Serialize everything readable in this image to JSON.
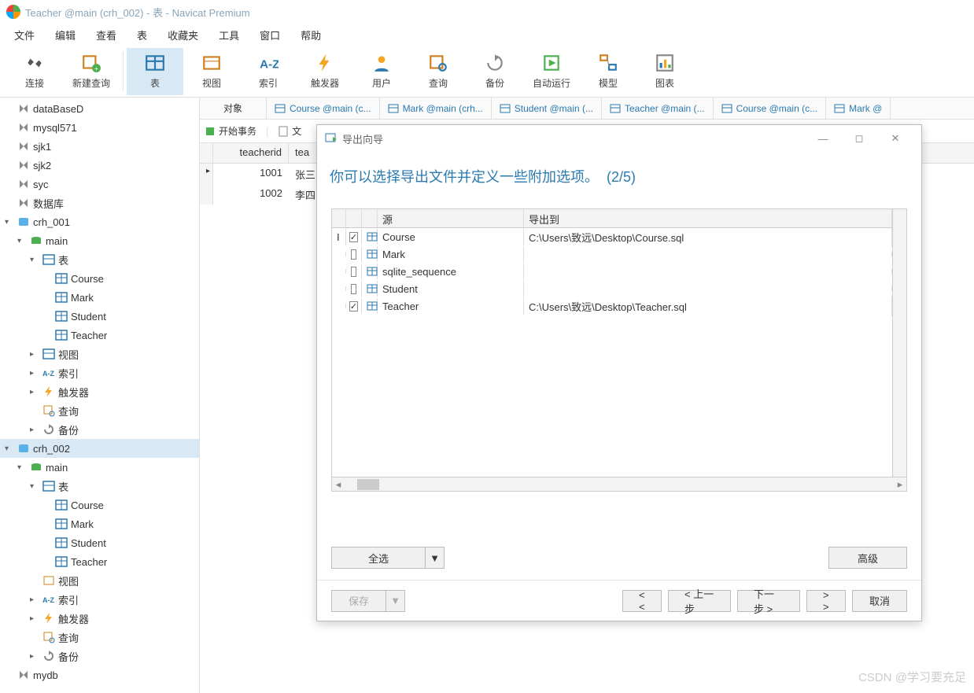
{
  "window": {
    "title": "Teacher @main (crh_002) - 表 - Navicat Premium"
  },
  "menu": [
    "文件",
    "编辑",
    "查看",
    "表",
    "收藏夹",
    "工具",
    "窗口",
    "帮助"
  ],
  "toolbar": [
    {
      "id": "connect",
      "label": "连接"
    },
    {
      "id": "newquery",
      "label": "新建查询"
    },
    {
      "id": "table",
      "label": "表",
      "active": true
    },
    {
      "id": "view",
      "label": "视图"
    },
    {
      "id": "index",
      "label": "索引"
    },
    {
      "id": "trigger",
      "label": "触发器"
    },
    {
      "id": "user",
      "label": "用户"
    },
    {
      "id": "query",
      "label": "查询"
    },
    {
      "id": "backup",
      "label": "备份"
    },
    {
      "id": "autorun",
      "label": "自动运行"
    },
    {
      "id": "model",
      "label": "模型"
    },
    {
      "id": "chart",
      "label": "图表"
    }
  ],
  "sidebar": [
    {
      "t": "conn",
      "label": "dataBaseD",
      "ind": 0
    },
    {
      "t": "conn",
      "label": "mysql571",
      "ind": 0
    },
    {
      "t": "conn",
      "label": "sjk1",
      "ind": 0
    },
    {
      "t": "conn",
      "label": "sjk2",
      "ind": 0
    },
    {
      "t": "conn",
      "label": "syc",
      "ind": 0
    },
    {
      "t": "conn",
      "label": "数据库",
      "ind": 0
    },
    {
      "t": "db",
      "label": "crh_001",
      "ind": 0,
      "caret": "▾",
      "open": true
    },
    {
      "t": "schema",
      "label": "main",
      "ind": 1,
      "caret": "▾"
    },
    {
      "t": "folder",
      "label": "表",
      "ind": 2,
      "caret": "▾"
    },
    {
      "t": "table",
      "label": "Course",
      "ind": 3
    },
    {
      "t": "table",
      "label": "Mark",
      "ind": 3
    },
    {
      "t": "table",
      "label": "Student",
      "ind": 3
    },
    {
      "t": "table",
      "label": "Teacher",
      "ind": 3
    },
    {
      "t": "folder",
      "label": "视图",
      "ind": 2,
      "caret": "▸"
    },
    {
      "t": "folder",
      "label": "索引",
      "ind": 2,
      "caret": "▸",
      "kind": "idx"
    },
    {
      "t": "folder",
      "label": "触发器",
      "ind": 2,
      "caret": "▸",
      "kind": "trg"
    },
    {
      "t": "folder",
      "label": "查询",
      "ind": 2,
      "kind": "qry"
    },
    {
      "t": "folder",
      "label": "备份",
      "ind": 2,
      "caret": "▸",
      "kind": "bak"
    },
    {
      "t": "db",
      "label": "crh_002",
      "ind": 0,
      "caret": "▾",
      "open": true,
      "selected": true
    },
    {
      "t": "schema",
      "label": "main",
      "ind": 1,
      "caret": "▾"
    },
    {
      "t": "folder",
      "label": "表",
      "ind": 2,
      "caret": "▾"
    },
    {
      "t": "table",
      "label": "Course",
      "ind": 3
    },
    {
      "t": "table",
      "label": "Mark",
      "ind": 3
    },
    {
      "t": "table",
      "label": "Student",
      "ind": 3
    },
    {
      "t": "table",
      "label": "Teacher",
      "ind": 3
    },
    {
      "t": "folder",
      "label": "视图",
      "ind": 2,
      "kind": "view"
    },
    {
      "t": "folder",
      "label": "索引",
      "ind": 2,
      "caret": "▸",
      "kind": "idx"
    },
    {
      "t": "folder",
      "label": "触发器",
      "ind": 2,
      "caret": "▸",
      "kind": "trg"
    },
    {
      "t": "folder",
      "label": "查询",
      "ind": 2,
      "kind": "qry"
    },
    {
      "t": "folder",
      "label": "备份",
      "ind": 2,
      "caret": "▸",
      "kind": "bak"
    },
    {
      "t": "conn",
      "label": "mydb",
      "ind": 0
    }
  ],
  "tabs": {
    "first": "对象",
    "items": [
      "Course @main (c...",
      "Mark @main (crh...",
      "Student @main (...",
      "Teacher @main (...",
      "Course @main (c...",
      "Mark @"
    ]
  },
  "actions": {
    "begin": "开始事务",
    "text": "文"
  },
  "table": {
    "headers": [
      "teacherid",
      "tea"
    ],
    "rows": [
      {
        "id": "1001",
        "name": "张三",
        "cur": true
      },
      {
        "id": "1002",
        "name": "李四"
      }
    ]
  },
  "dialog": {
    "title": "导出向导",
    "heading_a": "你可以选择导出文件并定义一些附加选项。",
    "heading_b": "(2/5)",
    "cols": {
      "source": "源",
      "dest": "导出到"
    },
    "rows": [
      {
        "chk": true,
        "name": "Course",
        "dest": "C:\\Users\\致远\\Desktop\\Course.sql",
        "cur": true
      },
      {
        "chk": false,
        "name": "Mark",
        "dest": ""
      },
      {
        "chk": false,
        "name": "sqlite_sequence",
        "dest": ""
      },
      {
        "chk": false,
        "name": "Student",
        "dest": ""
      },
      {
        "chk": true,
        "name": "Teacher",
        "dest": "C:\\Users\\致远\\Desktop\\Teacher.sql"
      }
    ],
    "btns": {
      "selectall": "全选",
      "advanced": "高级",
      "save": "保存",
      "back_icon": "< <",
      "back": "< 上一步",
      "next": "下一步 >",
      "next_icon": "> >",
      "cancel": "取消"
    }
  },
  "watermark": "CSDN @学习要充足"
}
